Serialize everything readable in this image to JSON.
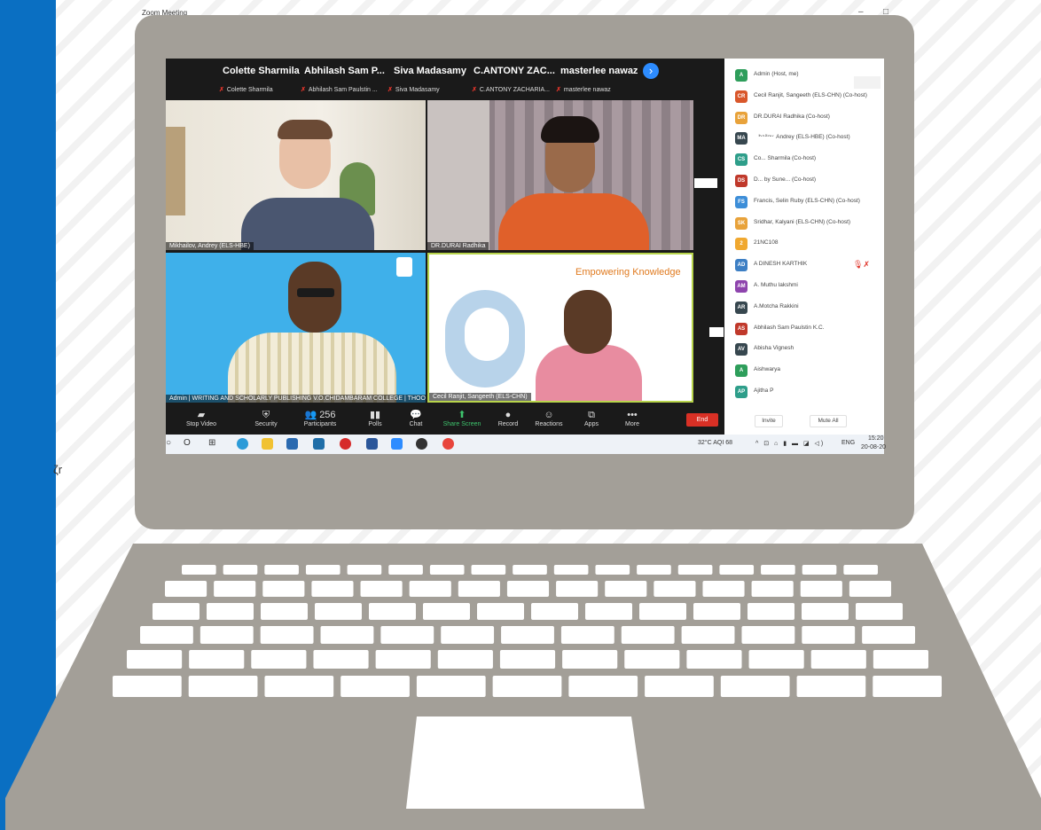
{
  "window": {
    "title": "Zoom Meeting",
    "controls": [
      "–",
      "□"
    ]
  },
  "stray_text": "ζr",
  "gallery": {
    "names": [
      "Colette Sharmila",
      "Abhilash Sam P...",
      "Siva Madasamy",
      "C.ANTONY  ZAC...",
      "masterlee nawaz"
    ],
    "subs": [
      "Colette Sharmila",
      "Abhilash Sam Paulstin ...",
      "Siva Madasamy",
      "C.ANTONY ZACHARIA...",
      "masterlee nawaz"
    ],
    "next_icon": "›"
  },
  "tiles": {
    "t1_label": "Mikhailov, Andrey (ELS-HBE)",
    "t2_label": "DR.DURAI Radhika",
    "t3_label": "Admin | WRITING AND SCHOLARLY PUBLISHING            V.O.CHIDAMBARAM COLLEGE | THOOT",
    "t4_label": "Cecil Ranjit, Sangeeth (ELS-CHN)",
    "t4_slide": "Empowering Knowledge"
  },
  "toolbar": [
    {
      "icon": "▰",
      "label": "Stop Video"
    },
    {
      "icon": "⛨",
      "label": "Security"
    },
    {
      "icon": "👥 256",
      "label": "Participants"
    },
    {
      "icon": "▮▮",
      "label": "Polls"
    },
    {
      "icon": "💬",
      "label": "Chat"
    },
    {
      "icon": "⬆",
      "label": "Share Screen"
    },
    {
      "icon": "●",
      "label": "Record"
    },
    {
      "icon": "☺",
      "label": "Reactions"
    },
    {
      "icon": "⧉",
      "label": "Apps"
    },
    {
      "icon": "•••",
      "label": "More"
    }
  ],
  "end_label": "End",
  "taskbar": {
    "weather": "32°C  AQI 68",
    "lang": "ENG",
    "time": "15:20",
    "date": "20-08-20"
  },
  "participants": [
    {
      "initials": "A",
      "name": "Admin (Host, me)",
      "color": "#2e9e5b"
    },
    {
      "initials": "CR",
      "name": "Cecil Ranjit, Sangeeth (ELS-CHN) (Co-host)",
      "color": "#d9572b"
    },
    {
      "initials": "DR",
      "name": "DR.DURAI Radhika (Co-host)",
      "color": "#e8a23a"
    },
    {
      "initials": "MA",
      "name": "...hailov, Andrey (ELS-HBE) (Co-host)",
      "color": "#37474f"
    },
    {
      "initials": "CS",
      "name": "Co...     Sharmila (Co-host)",
      "color": "#2e9e8a"
    },
    {
      "initials": "DS",
      "name": "D...     by Sune...  (Co-host)",
      "color": "#c0392b"
    },
    {
      "initials": "FS",
      "name": "Francis, Selin Ruby (ELS-CHN) (Co-host)",
      "color": "#3d8ed8"
    },
    {
      "initials": "SK",
      "name": "Sridhar, Kalyani (ELS-CHN) (Co-host)",
      "color": "#e8a23a"
    },
    {
      "initials": "2",
      "name": "21NC108",
      "color": "#f0a830"
    },
    {
      "initials": "AD",
      "name": "A DINESH KARTHIK",
      "color": "#3d7fc4"
    },
    {
      "initials": "AM",
      "name": "A. Muthu lakshmi",
      "color": "#8e44ad"
    },
    {
      "initials": "AR",
      "name": "A.Motcha Rakkini",
      "color": "#37474f"
    },
    {
      "initials": "AS",
      "name": "Abhilash Sam Paulstin K.C.",
      "color": "#c0392b"
    },
    {
      "initials": "AV",
      "name": "Abisha Vignesh",
      "color": "#37474f"
    },
    {
      "initials": "A",
      "name": "Aishwarya",
      "color": "#2e9e5b"
    },
    {
      "initials": "AP",
      "name": "Ajitha P",
      "color": "#2e9e8a"
    }
  ],
  "panel_buttons": {
    "invite": "Invite",
    "mute_all": "Mute All"
  },
  "colors": {
    "zoom_blue": "#2d8cff",
    "end_red": "#d93025",
    "laptop": "#a39f98",
    "band": "#0a6fc2"
  }
}
